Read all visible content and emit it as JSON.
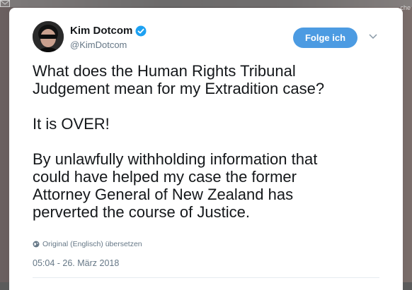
{
  "background": {
    "right_partial_text": "che"
  },
  "tweet": {
    "author_name": "Kim Dotcom",
    "author_handle": "@KimDotcom",
    "verified": true,
    "follow_label": "Folge ich",
    "text_lines": [
      "What does the Human Rights Tribunal",
      "Judgement mean for my Extradition case?",
      "It is OVER!",
      "By unlawfully withholding information that",
      "could have helped my case the former",
      "Attorney General of New Zealand has",
      "perverted the course of Justice."
    ],
    "translate_label": "Original (Englisch) übersetzen",
    "timestamp": "05:04 - 26. März 2018"
  },
  "colors": {
    "accent": "#4c9be2",
    "verified": "#1da1f2",
    "secondary_text": "#657786"
  }
}
